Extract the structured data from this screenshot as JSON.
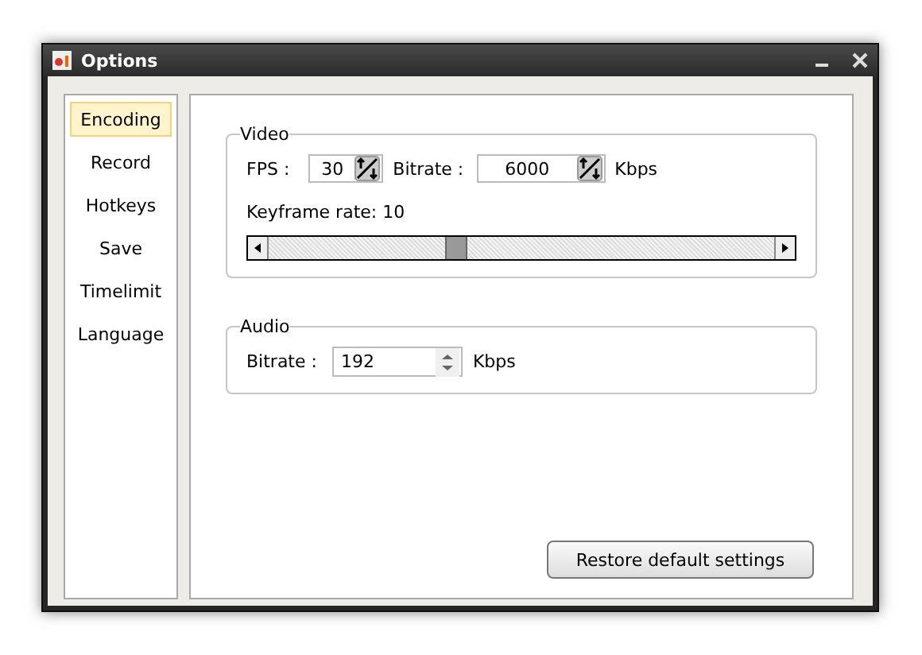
{
  "window": {
    "title": "Options"
  },
  "sidebar": {
    "items": [
      {
        "label": "Encoding",
        "selected": true
      },
      {
        "label": "Record",
        "selected": false
      },
      {
        "label": "Hotkeys",
        "selected": false
      },
      {
        "label": "Save",
        "selected": false
      },
      {
        "label": "Timelimit",
        "selected": false
      },
      {
        "label": "Language",
        "selected": false
      }
    ]
  },
  "video": {
    "title": "Video",
    "fps": {
      "label": "FPS :",
      "value": "30"
    },
    "bitrate": {
      "label": "Bitrate :",
      "value": "6000",
      "unit": "Kbps"
    },
    "keyframe": {
      "label": "Keyframe rate: 10",
      "level": 0.37
    }
  },
  "audio": {
    "title": "Audio",
    "bitrate": {
      "label": "Bitrate :",
      "value": "192",
      "unit": "Kbps"
    }
  },
  "buttons": [
    {
      "label": "Restore default settings"
    }
  ]
}
